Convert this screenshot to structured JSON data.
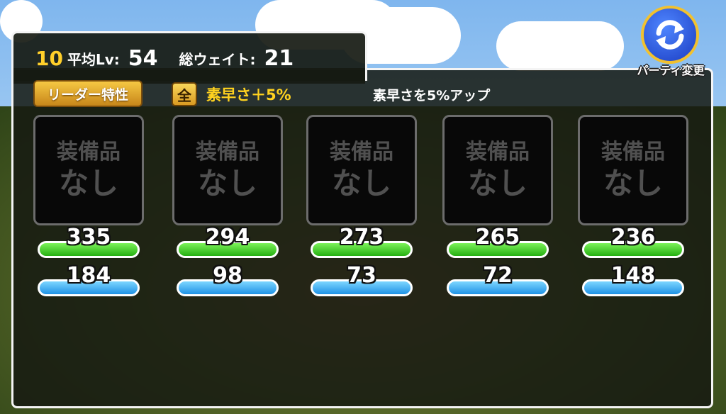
{
  "party": {
    "number": "10",
    "avg_level_label": "平均Lv:",
    "avg_level": "54",
    "total_weight_label": "総ウェイト:",
    "total_weight": "21"
  },
  "leader": {
    "badge_label": "リーダー特性",
    "scope_icon_text": "全",
    "effect": "素早さ＋5%",
    "description": "素早さを5%アップ"
  },
  "switch_button": {
    "label": "パーティ変更",
    "icon": "refresh-icon"
  },
  "members": [
    {
      "equip_line1": "装備品",
      "equip_line2": "なし",
      "hp": "335",
      "mp": "184"
    },
    {
      "equip_line1": "装備品",
      "equip_line2": "なし",
      "hp": "294",
      "mp": "98"
    },
    {
      "equip_line1": "装備品",
      "equip_line2": "なし",
      "hp": "273",
      "mp": "73"
    },
    {
      "equip_line1": "装備品",
      "equip_line2": "なし",
      "hp": "265",
      "mp": "72"
    },
    {
      "equip_line1": "装備品",
      "equip_line2": "なし",
      "hp": "236",
      "mp": "148"
    }
  ],
  "colors": {
    "hp_bar": "#26b012",
    "mp_bar": "#1f92e6",
    "accent_gold": "#ffd21f",
    "switch_blue": "#1a3cc2"
  }
}
